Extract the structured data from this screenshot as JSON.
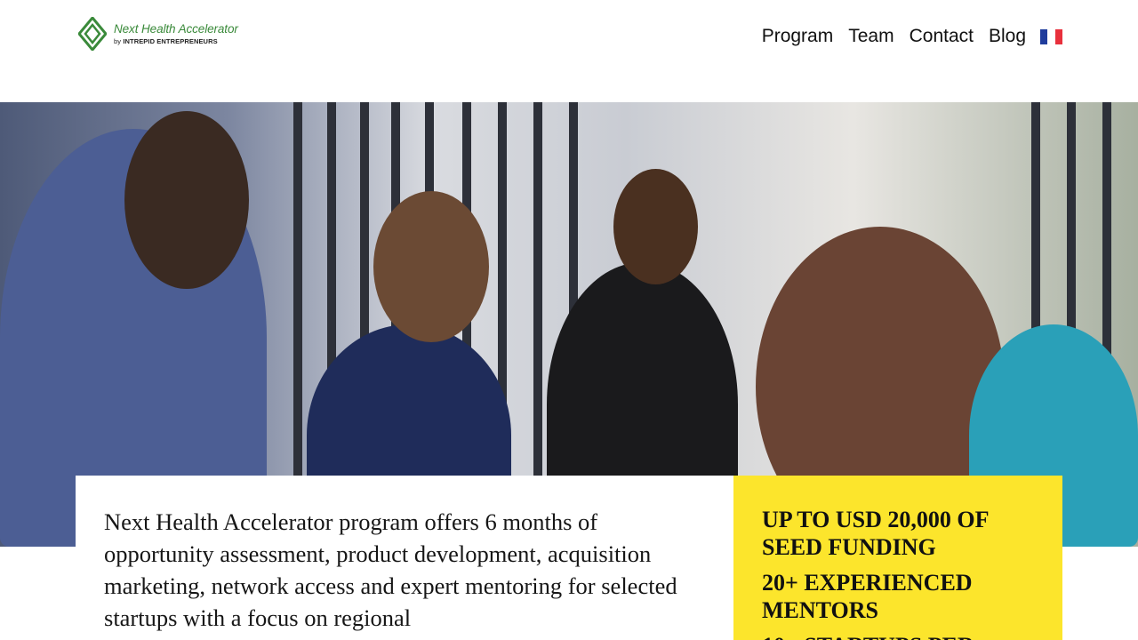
{
  "header": {
    "logo": {
      "title": "Next Health Accelerator",
      "subtitle_prefix": "by",
      "subtitle_brand": "INTREPID ENTREPRENEURS",
      "color": "#3a8a3a"
    },
    "nav": [
      {
        "label": "Program"
      },
      {
        "label": "Team"
      },
      {
        "label": "Contact"
      },
      {
        "label": "Blog"
      }
    ],
    "language_flag": {
      "icon": "france-flag-icon",
      "colors": [
        "#1f3c9c",
        "#ffffff",
        "#e8303c"
      ]
    }
  },
  "hero": {
    "image": "group-discussion-photo"
  },
  "intro": {
    "text": "Next Health Accelerator program offers 6 months of opportunity assessment, product development, acquisition marketing, network access and expert mentoring for selected startups with a focus on regional"
  },
  "stats": [
    {
      "label": "UP TO USD 20,000 OF SEED FUNDING"
    },
    {
      "label": "20+ EXPERIENCED MENTORS"
    },
    {
      "label": "10+ STARTUPS PER"
    }
  ],
  "colors": {
    "highlight": "#fce52c"
  }
}
